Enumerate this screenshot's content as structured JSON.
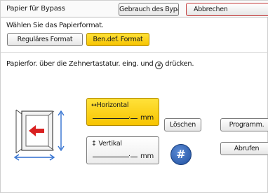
{
  "header": {
    "title": "Papier für Bypass",
    "use_bypass_label": "Gebrauch des Bypass",
    "cancel_label": "Abbrechen"
  },
  "format": {
    "hint": "Wählen Sie das Papierformat.",
    "regular_label": "Reguläres Format",
    "custom_label": "Ben.def. Format",
    "selected": "Ben.def. Format"
  },
  "entry": {
    "hint_before": "Papierfor. über die Zehnertastatur. eing. und",
    "hint_symbol": "#",
    "hint_after": "drücken.",
    "horizontal": {
      "arrow": "↔",
      "label": "Horizontal",
      "dot": ".",
      "unit": "mm"
    },
    "vertical": {
      "arrow": "↕",
      "label": "Vertikal",
      "dot": ".",
      "unit": "mm"
    }
  },
  "actions": {
    "clear_label": "Löschen",
    "program_label": "Programm.",
    "recall_label": "Abrufen",
    "hash_label": "#"
  },
  "colors": {
    "selected_yellow": "#f7c400",
    "hash_blue": "#1f4f9e",
    "cancel_border": "#c33a3a",
    "diagram_arrow_red": "#d92020",
    "diagram_blue": "#2f6fd0"
  }
}
